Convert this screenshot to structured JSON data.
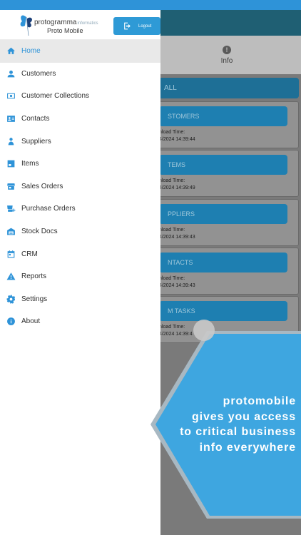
{
  "app": {
    "tabs": {
      "info_label": "Info"
    },
    "sync_all_label": "ALL",
    "cards": [
      {
        "button_label": "STOMERS",
        "label": "nload Time:",
        "time": "4/2024 14:39:44"
      },
      {
        "button_label": "TEMS",
        "label": "nload Time:",
        "time": "4/2024 14:39:49"
      },
      {
        "button_label": "PPLIERS",
        "label": "nload Time:",
        "time": "4/2024 14:39:43"
      },
      {
        "button_label": "NTACTS",
        "label": "nload Time:",
        "time": "4/2024 14:39:43"
      },
      {
        "button_label": "M TASKS",
        "label": "nload Time:",
        "time": "4/2024 14:39:4"
      }
    ]
  },
  "drawer": {
    "logo": {
      "brand": "protogramma",
      "tag": "informatics",
      "subtitle": "Proto Mobile"
    },
    "logout_label": "Logout",
    "items": [
      {
        "label": "Home",
        "icon": "home-icon",
        "active": true
      },
      {
        "label": "Customers",
        "icon": "person-icon"
      },
      {
        "label": "Customer Collections",
        "icon": "money-icon"
      },
      {
        "label": "Contacts",
        "icon": "contact-card-icon"
      },
      {
        "label": "Suppliers",
        "icon": "supplier-icon"
      },
      {
        "label": "Items",
        "icon": "item-box-icon"
      },
      {
        "label": "Sales Orders",
        "icon": "store-icon"
      },
      {
        "label": "Purchase Orders",
        "icon": "purchase-cart-icon"
      },
      {
        "label": "Stock Docs",
        "icon": "warehouse-icon"
      },
      {
        "label": "CRM",
        "icon": "calendar-icon"
      },
      {
        "label": "Reports",
        "icon": "warning-icon"
      },
      {
        "label": "Settings",
        "icon": "gear-icon"
      },
      {
        "label": "About",
        "icon": "info-icon"
      }
    ]
  },
  "promo": {
    "lines": [
      "protomobile",
      "gives you access",
      "to critical business",
      "info everywhere"
    ]
  },
  "colors": {
    "accent": "#2e93d8",
    "header_dark": "#1f5f73",
    "promo_blue": "#3ea6e0"
  }
}
